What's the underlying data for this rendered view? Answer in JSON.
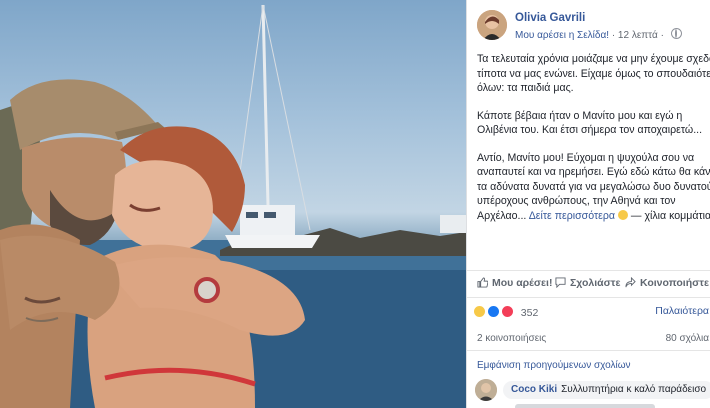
{
  "photo": {
    "alt": "couple embracing on a boat at sea"
  },
  "post": {
    "author": "Olivia Gavrili",
    "like_page": "Μου αρέσει η Σελίδα!",
    "time": "12 λεπτά",
    "paragraphs": {
      "p1": [
        "Τα τελευταία χρόνια μοιάζαμε να μην έχουμε σχεδόν",
        "τίποτα να μας ενώνει. Είχαμε όμως το σπουδαιότερο",
        "όλων: τα παιδιά μας."
      ],
      "p2": [
        "Κάποτε βέβαια ήταν ο Μανίτο μου και εγώ η",
        "Ολιβένια του. Και έτσι σήμερα τον αποχαιρετώ..."
      ],
      "p3": [
        "Αντίο, Μανίτο μου! Εύχομαι η ψυχούλα σου να",
        "αναπαυτεί και να ηρεμήσει. Εγώ εδώ κάτω θα κάνω",
        "τα αδύνατα δυνατά για να μεγαλώσω δυο δυνατούς",
        "υπέροχους ανθρώπους, την Αθηνά και τον",
        "Αρχέλαο..."
      ]
    },
    "see_more": "Δείτε περισσότερα",
    "feeling": "— χίλια κομμάτια."
  },
  "actions": {
    "like": "Μου αρέσει!",
    "comment": "Σχολιάστε",
    "share": "Κοινοποιήστε"
  },
  "reactions": {
    "count": "352",
    "sort": "Παλαιότερα",
    "colors": [
      "#f7c948",
      "#1877f2",
      "#f33e58"
    ]
  },
  "stats": {
    "shares": "2 κοινοποιήσεις",
    "comments": "80 σχόλια"
  },
  "previous_comments": "Εμφάνιση προηγούμενων σχολίων",
  "comment": {
    "name": "Coco Kiki",
    "text": "Συλλυπητήρια κ καλό παράδεισο"
  }
}
